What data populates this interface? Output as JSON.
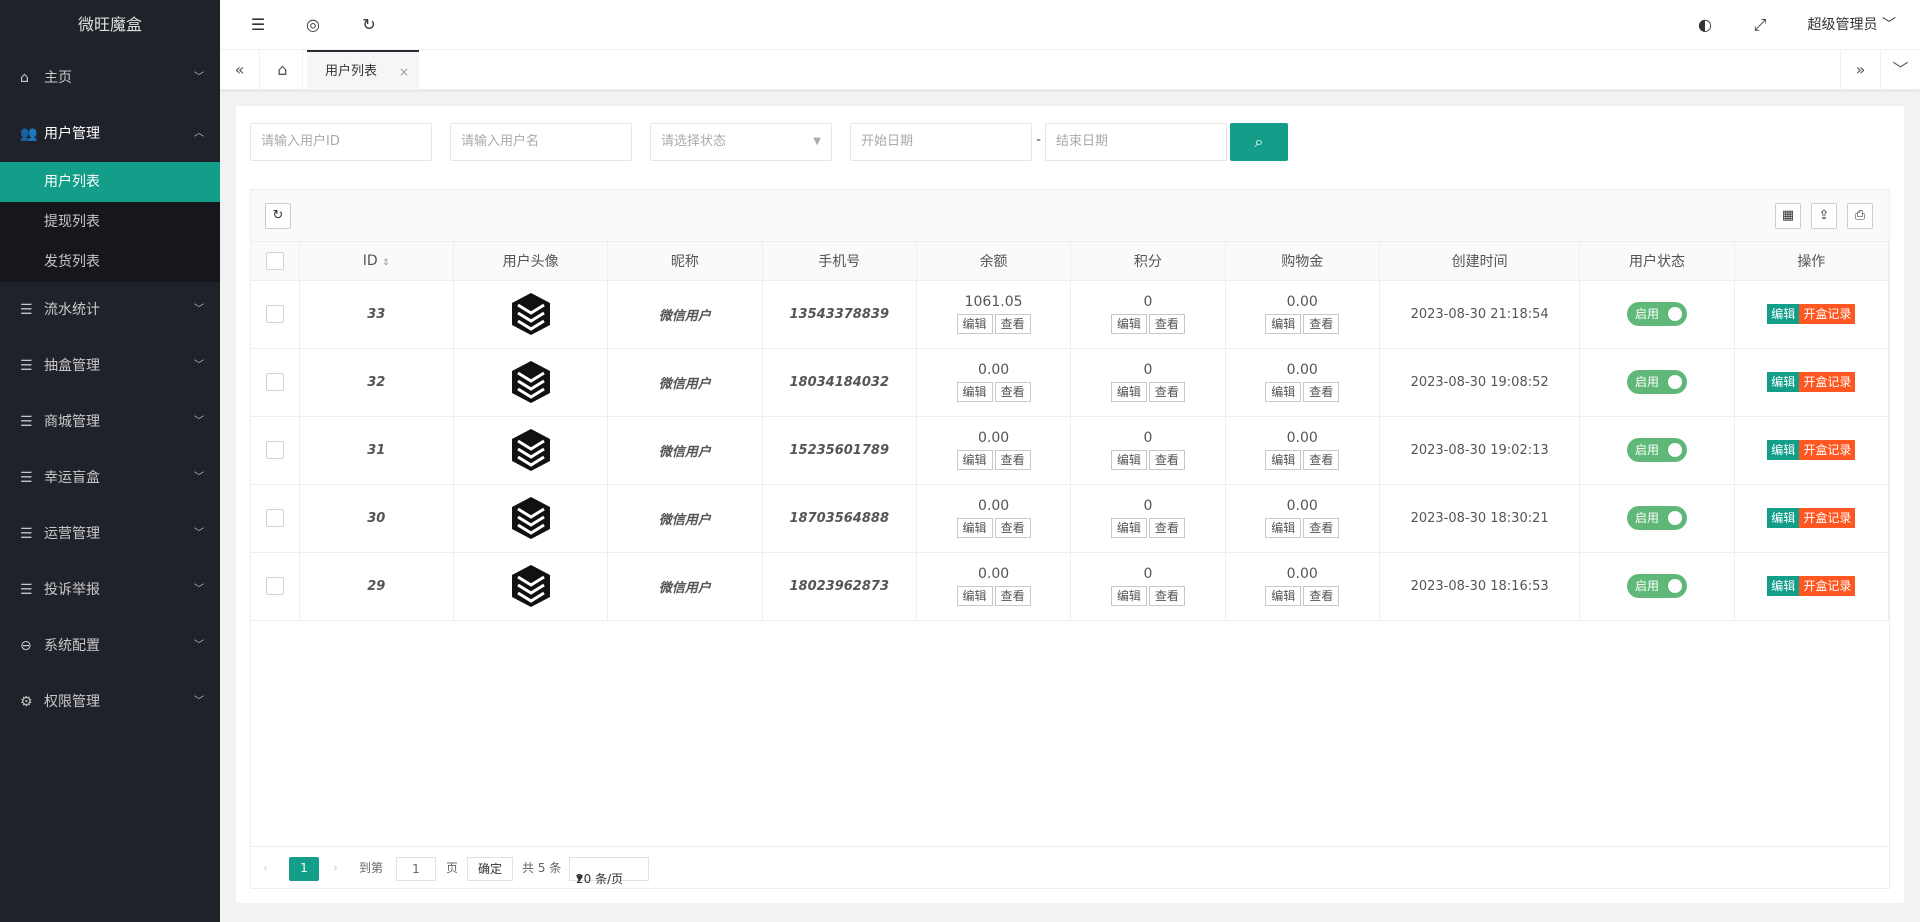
{
  "app": {
    "title": "微旺魔盒"
  },
  "sidebar": {
    "items": [
      {
        "label": "主页",
        "icon": "home-icon"
      },
      {
        "label": "用户管理",
        "icon": "users-icon"
      },
      {
        "label": "流水统计",
        "icon": "list-icon"
      },
      {
        "label": "抽盒管理",
        "icon": "list-icon"
      },
      {
        "label": "商城管理",
        "icon": "list-icon"
      },
      {
        "label": "幸运盲盒",
        "icon": "list-icon"
      },
      {
        "label": "运营管理",
        "icon": "list-icon"
      },
      {
        "label": "投诉举报",
        "icon": "list-icon"
      },
      {
        "label": "系统配置",
        "icon": "settings-icon"
      },
      {
        "label": "权限管理",
        "icon": "gear-icon"
      }
    ],
    "submenu": [
      {
        "label": "用户列表"
      },
      {
        "label": "提现列表"
      },
      {
        "label": "发货列表"
      }
    ]
  },
  "header": {
    "user": "超级管理员"
  },
  "tabs": {
    "active": "用户列表"
  },
  "filters": {
    "user_id_placeholder": "请输入用户ID",
    "username_placeholder": "请输入用户名",
    "status_placeholder": "请选择状态",
    "start_date_placeholder": "开始日期",
    "date_sep": "-",
    "end_date_placeholder": "结束日期"
  },
  "table": {
    "columns": [
      "ID",
      "用户头像",
      "昵称",
      "手机号",
      "余额",
      "积分",
      "购物金",
      "创建时间",
      "用户状态",
      "操作"
    ],
    "rows": [
      {
        "id": "33",
        "nickname": "微信用户",
        "phone": "13543378839",
        "balance": "1061.05",
        "points": "0",
        "shopping": "0.00",
        "created": "2023-08-30 21:18:54",
        "status": "启用"
      },
      {
        "id": "32",
        "nickname": "微信用户",
        "phone": "18034184032",
        "balance": "0.00",
        "points": "0",
        "shopping": "0.00",
        "created": "2023-08-30 19:08:52",
        "status": "启用"
      },
      {
        "id": "31",
        "nickname": "微信用户",
        "phone": "15235601789",
        "balance": "0.00",
        "points": "0",
        "shopping": "0.00",
        "created": "2023-08-30 19:02:13",
        "status": "启用"
      },
      {
        "id": "30",
        "nickname": "微信用户",
        "phone": "18703564888",
        "balance": "0.00",
        "points": "0",
        "shopping": "0.00",
        "created": "2023-08-30 18:30:21",
        "status": "启用"
      },
      {
        "id": "29",
        "nickname": "微信用户",
        "phone": "18023962873",
        "balance": "0.00",
        "points": "0",
        "shopping": "0.00",
        "created": "2023-08-30 18:16:53",
        "status": "启用"
      }
    ],
    "cell_buttons": {
      "edit": "编辑",
      "view": "查看"
    },
    "actions": {
      "edit": "编辑",
      "record": "开盒记录"
    }
  },
  "pager": {
    "current": "1",
    "goto_label": "到第",
    "page_value": "1",
    "page_unit": "页",
    "confirm": "确定",
    "total": "共 5 条",
    "page_size": "20 条/页"
  },
  "colors": {
    "sidebar_bg": "#20222a",
    "accent": "#129e89",
    "switch_on": "#5fb878",
    "danger": "#ff5722"
  }
}
